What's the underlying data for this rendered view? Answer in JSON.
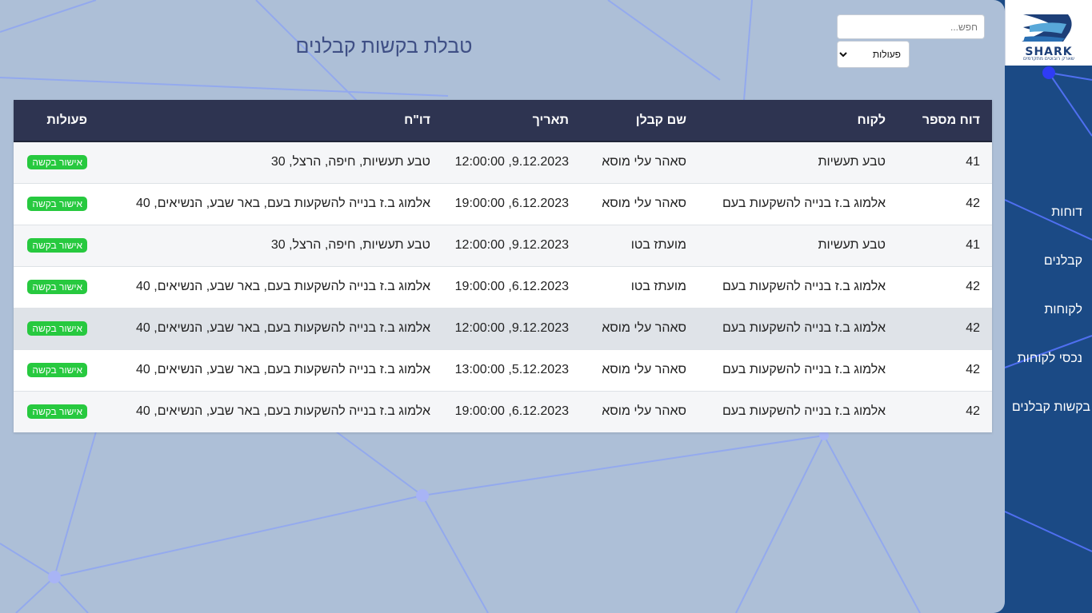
{
  "sidebar": {
    "logo": {
      "brand": "SHARK",
      "tagline": "שארק רובוטים מתקדמים"
    },
    "items": [
      {
        "label": "דוחות"
      },
      {
        "label": "קבלנים"
      },
      {
        "label": "לקוחות"
      },
      {
        "label": "נכסי לקוחות"
      },
      {
        "label": "בקשות קבלנים"
      }
    ]
  },
  "header": {
    "title": "טבלת בקשות קבלנים",
    "search_placeholder": "חפש...",
    "actions_select": "פעולות"
  },
  "table": {
    "columns": [
      "דוח מספר",
      "לקוח",
      "שם קבלן",
      "תאריך",
      "דו\"ח",
      "פעולות"
    ],
    "rows": [
      {
        "report": "41",
        "client": "טבע תעשיות",
        "contractor": "סאהר עלי מוסא",
        "date": "9.12.2023, 12:00:00",
        "details": "טבע תעשיות, חיפה, הרצל, 30",
        "action": "אישור בקשה"
      },
      {
        "report": "42",
        "client": "אלמוג ב.ז בנייה להשקעות בעם",
        "contractor": "סאהר עלי מוסא",
        "date": "6.12.2023, 19:00:00",
        "details": "אלמוג ב.ז בנייה להשקעות בעם, באר שבע, הנשיאים, 40",
        "action": "אישור בקשה"
      },
      {
        "report": "41",
        "client": "טבע תעשיות",
        "contractor": "מועתז בטו",
        "date": "9.12.2023, 12:00:00",
        "details": "טבע תעשיות, חיפה, הרצל, 30",
        "action": "אישור בקשה"
      },
      {
        "report": "42",
        "client": "אלמוג ב.ז בנייה להשקעות בעם",
        "contractor": "מועתז בטו",
        "date": "6.12.2023, 19:00:00",
        "details": "אלמוג ב.ז בנייה להשקעות בעם, באר שבע, הנשיאים, 40",
        "action": "אישור בקשה"
      },
      {
        "report": "42",
        "client": "אלמוג ב.ז בנייה להשקעות בעם",
        "contractor": "סאהר עלי מוסא",
        "date": "9.12.2023, 12:00:00",
        "details": "אלמוג ב.ז בנייה להשקעות בעם, באר שבע, הנשיאים, 40",
        "action": "אישור בקשה"
      },
      {
        "report": "42",
        "client": "אלמוג ב.ז בנייה להשקעות בעם",
        "contractor": "סאהר עלי מוסא",
        "date": "5.12.2023, 13:00:00",
        "details": "אלמוג ב.ז בנייה להשקעות בעם, באר שבע, הנשיאים, 40",
        "action": "אישור בקשה"
      },
      {
        "report": "42",
        "client": "אלמוג ב.ז בנייה להשקעות בעם",
        "contractor": "סאהר עלי מוסא",
        "date": "6.12.2023, 19:00:00",
        "details": "אלמוג ב.ז בנייה להשקעות בעם, באר שבע, הנשיאים, 40",
        "action": "אישור בקשה"
      }
    ]
  },
  "colors": {
    "sidebar_bg": "#1b4a85",
    "main_bg": "#adbfd7",
    "table_header_bg": "#2e3451",
    "badge_green": "#27c93f",
    "title_color": "#3f4f85"
  }
}
